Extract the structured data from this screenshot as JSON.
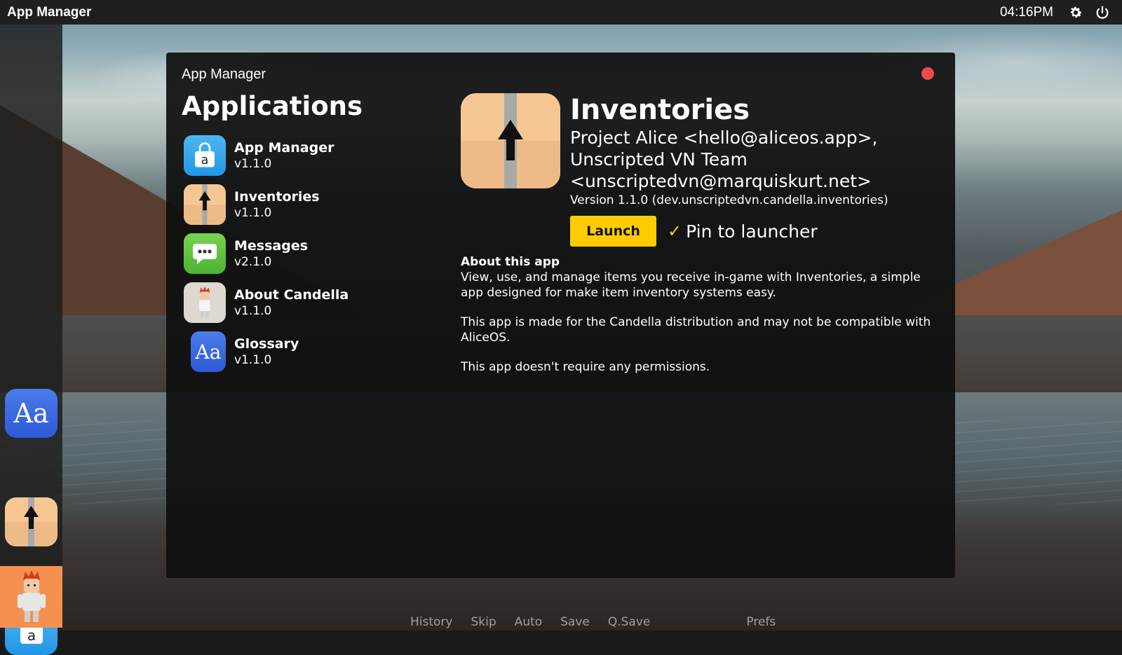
{
  "topbar": {
    "title": "App Manager",
    "clock": "04:16PM",
    "icons": [
      "gear-icon",
      "power-icon"
    ]
  },
  "dock": {
    "items": [
      {
        "name": "Glossary",
        "icon": "glossary-icon"
      },
      {
        "name": "Inventories",
        "icon": "box-arrow-icon"
      },
      {
        "name": "App Manager",
        "icon": "store-bag-icon"
      },
      {
        "name": "About Candella",
        "icon": "avatar-icon",
        "active": true
      }
    ]
  },
  "window": {
    "title": "App Manager",
    "sidebar": {
      "heading": "Applications",
      "apps": [
        {
          "name": "App Manager",
          "version": "v1.1.0",
          "icon": "store-bag-icon"
        },
        {
          "name": "Inventories",
          "version": "v1.1.0",
          "icon": "box-arrow-icon"
        },
        {
          "name": "Messages",
          "version": "v2.1.0",
          "icon": "chat-bubble-icon"
        },
        {
          "name": "About Candella",
          "version": "v1.1.0",
          "icon": "avatar-icon"
        },
        {
          "name": "Glossary",
          "version": "v1.1.0",
          "icon": "glossary-icon"
        }
      ]
    },
    "detail": {
      "name": "Inventories",
      "authors_line1": "Project Alice <hello@aliceos.app>,",
      "authors_line2": "Unscripted VN Team",
      "authors_line3": "<unscriptedvn@marquiskurt.net>",
      "version": "Version 1.1.0 (dev.unscriptedvn.candella.inventories)",
      "launch_label": "Launch",
      "pin_label": "Pin to launcher",
      "pin_checked": true,
      "about_heading": "About this app",
      "about_text": "View, use, and manage items you receive in-game with Inventories, a simple app designed for make item inventory systems easy.",
      "compat_text": "This app is made for the Candella distribution and may not be compatible with AliceOS.",
      "permissions_text": "This app doesn't require any permissions."
    }
  },
  "quickmenu": {
    "history": "History",
    "skip": "Skip",
    "auto": "Auto",
    "save": "Save",
    "qsave": "Q.Save",
    "prefs": "Prefs"
  },
  "colors": {
    "accent": "#ffcc00",
    "close": "#ef4a4a",
    "dock_active": "#f5904e",
    "topbar": "#1f1f1f"
  }
}
